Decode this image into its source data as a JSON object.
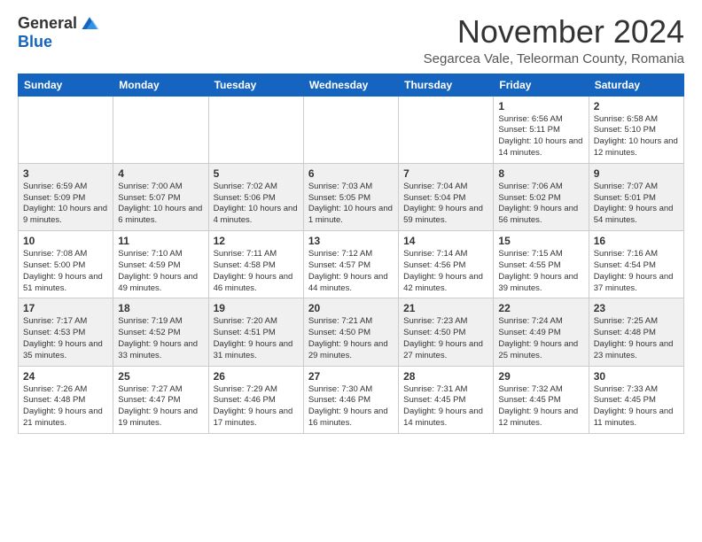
{
  "header": {
    "logo_general": "General",
    "logo_blue": "Blue",
    "month_title": "November 2024",
    "subtitle": "Segarcea Vale, Teleorman County, Romania"
  },
  "weekdays": [
    "Sunday",
    "Monday",
    "Tuesday",
    "Wednesday",
    "Thursday",
    "Friday",
    "Saturday"
  ],
  "weeks": [
    [
      {
        "day": "",
        "info": ""
      },
      {
        "day": "",
        "info": ""
      },
      {
        "day": "",
        "info": ""
      },
      {
        "day": "",
        "info": ""
      },
      {
        "day": "",
        "info": ""
      },
      {
        "day": "1",
        "info": "Sunrise: 6:56 AM\nSunset: 5:11 PM\nDaylight: 10 hours and 14 minutes."
      },
      {
        "day": "2",
        "info": "Sunrise: 6:58 AM\nSunset: 5:10 PM\nDaylight: 10 hours and 12 minutes."
      }
    ],
    [
      {
        "day": "3",
        "info": "Sunrise: 6:59 AM\nSunset: 5:09 PM\nDaylight: 10 hours and 9 minutes."
      },
      {
        "day": "4",
        "info": "Sunrise: 7:00 AM\nSunset: 5:07 PM\nDaylight: 10 hours and 6 minutes."
      },
      {
        "day": "5",
        "info": "Sunrise: 7:02 AM\nSunset: 5:06 PM\nDaylight: 10 hours and 4 minutes."
      },
      {
        "day": "6",
        "info": "Sunrise: 7:03 AM\nSunset: 5:05 PM\nDaylight: 10 hours and 1 minute."
      },
      {
        "day": "7",
        "info": "Sunrise: 7:04 AM\nSunset: 5:04 PM\nDaylight: 9 hours and 59 minutes."
      },
      {
        "day": "8",
        "info": "Sunrise: 7:06 AM\nSunset: 5:02 PM\nDaylight: 9 hours and 56 minutes."
      },
      {
        "day": "9",
        "info": "Sunrise: 7:07 AM\nSunset: 5:01 PM\nDaylight: 9 hours and 54 minutes."
      }
    ],
    [
      {
        "day": "10",
        "info": "Sunrise: 7:08 AM\nSunset: 5:00 PM\nDaylight: 9 hours and 51 minutes."
      },
      {
        "day": "11",
        "info": "Sunrise: 7:10 AM\nSunset: 4:59 PM\nDaylight: 9 hours and 49 minutes."
      },
      {
        "day": "12",
        "info": "Sunrise: 7:11 AM\nSunset: 4:58 PM\nDaylight: 9 hours and 46 minutes."
      },
      {
        "day": "13",
        "info": "Sunrise: 7:12 AM\nSunset: 4:57 PM\nDaylight: 9 hours and 44 minutes."
      },
      {
        "day": "14",
        "info": "Sunrise: 7:14 AM\nSunset: 4:56 PM\nDaylight: 9 hours and 42 minutes."
      },
      {
        "day": "15",
        "info": "Sunrise: 7:15 AM\nSunset: 4:55 PM\nDaylight: 9 hours and 39 minutes."
      },
      {
        "day": "16",
        "info": "Sunrise: 7:16 AM\nSunset: 4:54 PM\nDaylight: 9 hours and 37 minutes."
      }
    ],
    [
      {
        "day": "17",
        "info": "Sunrise: 7:17 AM\nSunset: 4:53 PM\nDaylight: 9 hours and 35 minutes."
      },
      {
        "day": "18",
        "info": "Sunrise: 7:19 AM\nSunset: 4:52 PM\nDaylight: 9 hours and 33 minutes."
      },
      {
        "day": "19",
        "info": "Sunrise: 7:20 AM\nSunset: 4:51 PM\nDaylight: 9 hours and 31 minutes."
      },
      {
        "day": "20",
        "info": "Sunrise: 7:21 AM\nSunset: 4:50 PM\nDaylight: 9 hours and 29 minutes."
      },
      {
        "day": "21",
        "info": "Sunrise: 7:23 AM\nSunset: 4:50 PM\nDaylight: 9 hours and 27 minutes."
      },
      {
        "day": "22",
        "info": "Sunrise: 7:24 AM\nSunset: 4:49 PM\nDaylight: 9 hours and 25 minutes."
      },
      {
        "day": "23",
        "info": "Sunrise: 7:25 AM\nSunset: 4:48 PM\nDaylight: 9 hours and 23 minutes."
      }
    ],
    [
      {
        "day": "24",
        "info": "Sunrise: 7:26 AM\nSunset: 4:48 PM\nDaylight: 9 hours and 21 minutes."
      },
      {
        "day": "25",
        "info": "Sunrise: 7:27 AM\nSunset: 4:47 PM\nDaylight: 9 hours and 19 minutes."
      },
      {
        "day": "26",
        "info": "Sunrise: 7:29 AM\nSunset: 4:46 PM\nDaylight: 9 hours and 17 minutes."
      },
      {
        "day": "27",
        "info": "Sunrise: 7:30 AM\nSunset: 4:46 PM\nDaylight: 9 hours and 16 minutes."
      },
      {
        "day": "28",
        "info": "Sunrise: 7:31 AM\nSunset: 4:45 PM\nDaylight: 9 hours and 14 minutes."
      },
      {
        "day": "29",
        "info": "Sunrise: 7:32 AM\nSunset: 4:45 PM\nDaylight: 9 hours and 12 minutes."
      },
      {
        "day": "30",
        "info": "Sunrise: 7:33 AM\nSunset: 4:45 PM\nDaylight: 9 hours and 11 minutes."
      }
    ]
  ]
}
